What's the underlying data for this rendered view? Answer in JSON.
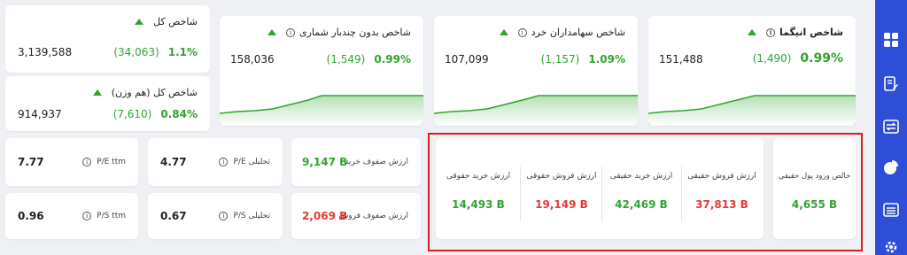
{
  "indices": {
    "total": {
      "title": "شاخص کل",
      "value": "3,139,588",
      "change": "(34,063)",
      "percent": "1.1%"
    },
    "equal_weight": {
      "title": "شاخص کل (هم وزن)",
      "value": "914,937",
      "change": "(7,610)",
      "percent": "0.84%"
    },
    "no_multi_volume": {
      "title": "شاخص بدون چندبار شماری",
      "value": "158,036",
      "change": "(1,549)",
      "percent": "0.99%"
    },
    "retail": {
      "title": "شاخص سهامداران خرد",
      "value": "107,099",
      "change": "(1,157)",
      "percent": "1.09%"
    },
    "inigma": {
      "title": "شاخص انیگما",
      "value": "151,488",
      "change": "(1,490)",
      "percent": "0.99%"
    }
  },
  "ratios": {
    "pe_ttm": {
      "label": "P/E ttm",
      "value": "7.77"
    },
    "pe_analytic": {
      "label": "P/E تحلیلی",
      "value": "4.77"
    },
    "ps_ttm": {
      "label": "P/S ttm",
      "value": "0.96"
    },
    "ps_analytic": {
      "label": "P/S تحلیلی",
      "value": "0.67"
    }
  },
  "queues": {
    "buy": {
      "label": "ارزش صفوف خرید",
      "value": "9,147 B"
    },
    "sell": {
      "label": "ارزش صفوف فروش",
      "value": "2,069 B"
    }
  },
  "money_flow": {
    "legal_buy": {
      "label": "ارزش خرید حقوقی",
      "value": "14,493 B"
    },
    "legal_sell": {
      "label": "ارزش فروش حقوقی",
      "value": "19,149 B"
    },
    "real_buy": {
      "label": "ارزش خرید حقیقی",
      "value": "42,469 B"
    },
    "real_sell": {
      "label": "ارزش فروش حقیقی",
      "value": "37,813 B"
    },
    "net_real": {
      "label": "خالص ورود پول حقیقی",
      "value": "4,655 B"
    }
  },
  "sidebar": {
    "items": [
      {
        "icon": "dashboard-icon"
      },
      {
        "icon": "report-edit-icon"
      },
      {
        "icon": "exchange-icon"
      },
      {
        "icon": "pie-chart-icon"
      },
      {
        "icon": "calculator-icon"
      },
      {
        "icon": "settings-icon"
      }
    ]
  },
  "colors": {
    "positive": "#2fa52f",
    "negative": "#e53935",
    "highlight": "#e0191f",
    "sidebar": "#2f4ed8"
  }
}
